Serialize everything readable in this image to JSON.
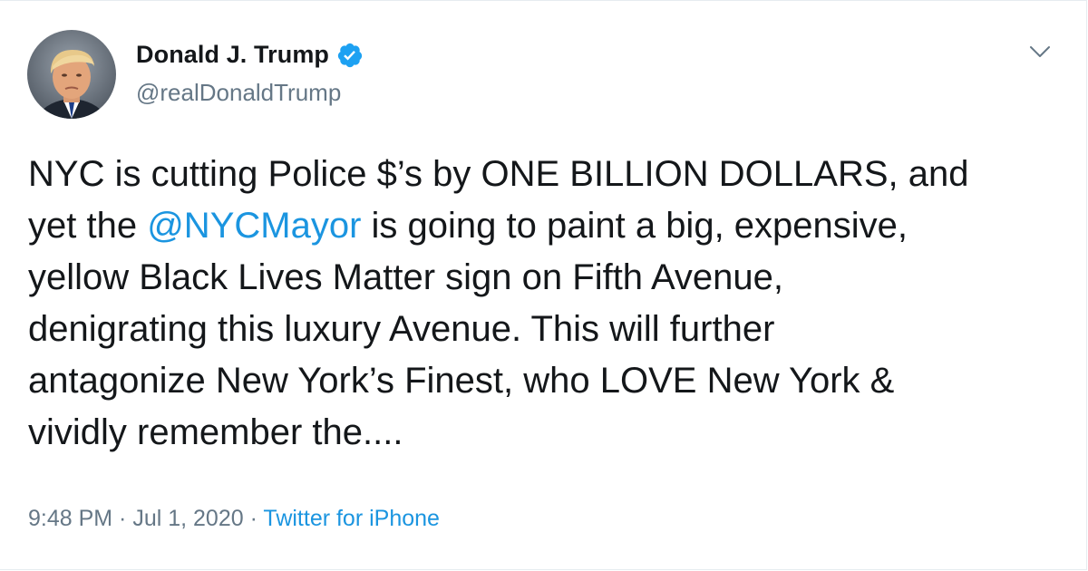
{
  "user": {
    "display_name": "Donald J. Trump",
    "handle": "@realDonaldTrump",
    "verified": true
  },
  "tweet": {
    "line1": "NYC is cutting Police $’s by ONE BILLION DOLLARS, and",
    "line2_prefix": "yet the ",
    "line2_mention": "@NYCMayor",
    "line2_suffix": " is going to paint a big, expensive,",
    "line3": "yellow Black Lives Matter sign on Fifth Avenue,",
    "line4": "denigrating this luxury Avenue. This will further",
    "line5": "antagonize New York’s Finest, who LOVE New York &",
    "line6": "vividly remember the...."
  },
  "meta": {
    "time": "9:48 PM",
    "sep1": " · ",
    "date": "Jul 1, 2020",
    "sep2": " · ",
    "source": "Twitter for iPhone"
  },
  "colors": {
    "link": "#1b95e0",
    "text": "#14171a",
    "muted": "#657786",
    "verified_badge": "#1da1f2"
  },
  "icons": {
    "verified": "verified-badge-icon",
    "caret": "chevron-down-icon"
  }
}
